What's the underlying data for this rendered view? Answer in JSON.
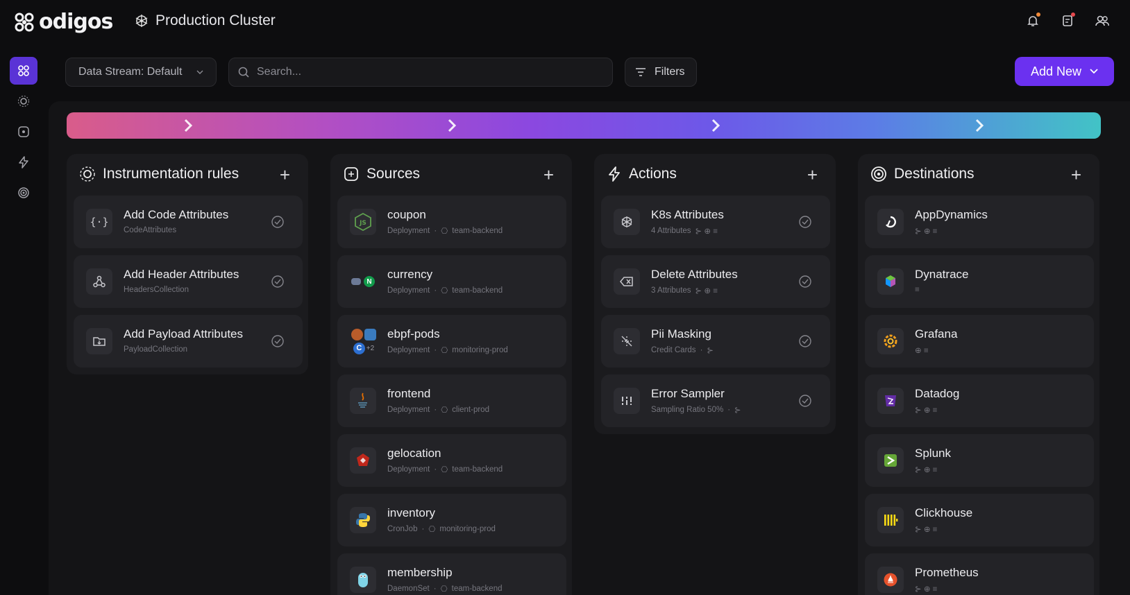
{
  "brand": {
    "name": "odigos"
  },
  "header": {
    "cluster_name": "Production Cluster",
    "icons": [
      "bell-icon",
      "notes-icon",
      "users-icon"
    ]
  },
  "sidebar": {
    "items": [
      "overview-icon",
      "rules-icon",
      "sources-icon",
      "actions-icon",
      "destinations-icon"
    ]
  },
  "toolbar": {
    "stream_label": "Data Stream: Default",
    "search_placeholder": "Search...",
    "filters_label": "Filters",
    "add_new_label": "Add New"
  },
  "columns": {
    "rules": {
      "title": "Instrumentation rules",
      "items": [
        {
          "title": "Add Code Attributes",
          "sub": "CodeAttributes"
        },
        {
          "title": "Add Header Attributes",
          "sub": "HeadersCollection"
        },
        {
          "title": "Add Payload Attributes",
          "sub": "PayloadCollection"
        }
      ]
    },
    "sources": {
      "title": "Sources",
      "items": [
        {
          "title": "coupon",
          "kind": "Deployment",
          "ns": "team-backend",
          "icon": "nodejs-icon"
        },
        {
          "title": "currency",
          "kind": "Deployment",
          "ns": "team-backend",
          "icon": "nginx-icon"
        },
        {
          "title": "ebpf-pods",
          "kind": "Deployment",
          "ns": "monitoring-prod",
          "icon": "multi-lang-icon",
          "extra": "+2"
        },
        {
          "title": "frontend",
          "kind": "Deployment",
          "ns": "client-prod",
          "icon": "java-icon"
        },
        {
          "title": "gelocation",
          "kind": "Deployment",
          "ns": "team-backend",
          "icon": "ruby-icon"
        },
        {
          "title": "inventory",
          "kind": "CronJob",
          "ns": "monitoring-prod",
          "icon": "python-icon"
        },
        {
          "title": "membership",
          "kind": "DaemonSet",
          "ns": "team-backend",
          "icon": "go-icon"
        }
      ]
    },
    "actions": {
      "title": "Actions",
      "items": [
        {
          "title": "K8s Attributes",
          "sub": "4 Attributes"
        },
        {
          "title": "Delete Attributes",
          "sub": "3 Attributes"
        },
        {
          "title": "Pii Masking",
          "sub": "Credit Cards"
        },
        {
          "title": "Error Sampler",
          "sub": "Sampling Ratio 50%"
        }
      ]
    },
    "destinations": {
      "title": "Destinations",
      "items": [
        {
          "title": "AppDynamics"
        },
        {
          "title": "Dynatrace"
        },
        {
          "title": "Grafana"
        },
        {
          "title": "Datadog"
        },
        {
          "title": "Splunk"
        },
        {
          "title": "Clickhouse"
        },
        {
          "title": "Prometheus"
        }
      ]
    }
  },
  "colors": {
    "accent": "#6b31f0",
    "background": "#0d0d0f",
    "card": "#232327"
  }
}
